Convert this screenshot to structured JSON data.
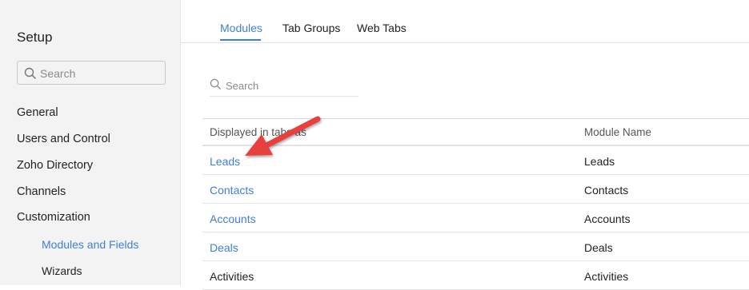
{
  "sidebar": {
    "title": "Setup",
    "search_placeholder": "Search",
    "items": [
      {
        "label": "General"
      },
      {
        "label": "Users and Control"
      },
      {
        "label": "Zoho Directory"
      },
      {
        "label": "Channels"
      },
      {
        "label": "Customization"
      }
    ],
    "sub_items": [
      {
        "label": "Modules and Fields",
        "active": true
      },
      {
        "label": "Wizards",
        "active": false
      }
    ]
  },
  "tabs": [
    {
      "label": "Modules",
      "active": true
    },
    {
      "label": "Tab Groups",
      "active": false
    },
    {
      "label": "Web Tabs",
      "active": false
    }
  ],
  "main": {
    "search_placeholder": "Search",
    "columns": [
      "Displayed in tabs as",
      "Module Name"
    ],
    "rows": [
      {
        "display": "Leads",
        "module": "Leads",
        "link": true
      },
      {
        "display": "Contacts",
        "module": "Contacts",
        "link": true
      },
      {
        "display": "Accounts",
        "module": "Accounts",
        "link": true
      },
      {
        "display": "Deals",
        "module": "Deals",
        "link": true
      },
      {
        "display": "Activities",
        "module": "Activities",
        "link": false
      }
    ]
  },
  "colors": {
    "accent": "#3f7fd8",
    "annotation_arrow": "#e8403c",
    "sidebar_bg": "#f3f3f3"
  }
}
